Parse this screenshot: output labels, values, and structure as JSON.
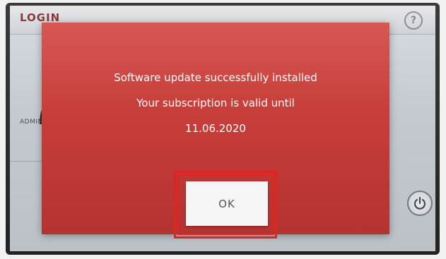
{
  "background_screen": {
    "header_title": "LOGIN",
    "help_icon_glyph": "?",
    "user_label": "ADMIN"
  },
  "dialog": {
    "line1": "Software update successfully installed",
    "line2": "Your subscription is valid until",
    "line3": "11.06.2020",
    "ok_label": "OK"
  },
  "colors": {
    "dialog_red": "#c63c38",
    "highlight_red": "#e0241f",
    "button_bg": "#f6f6f6"
  },
  "icons": [
    "help-icon",
    "user-icon",
    "power-icon"
  ]
}
